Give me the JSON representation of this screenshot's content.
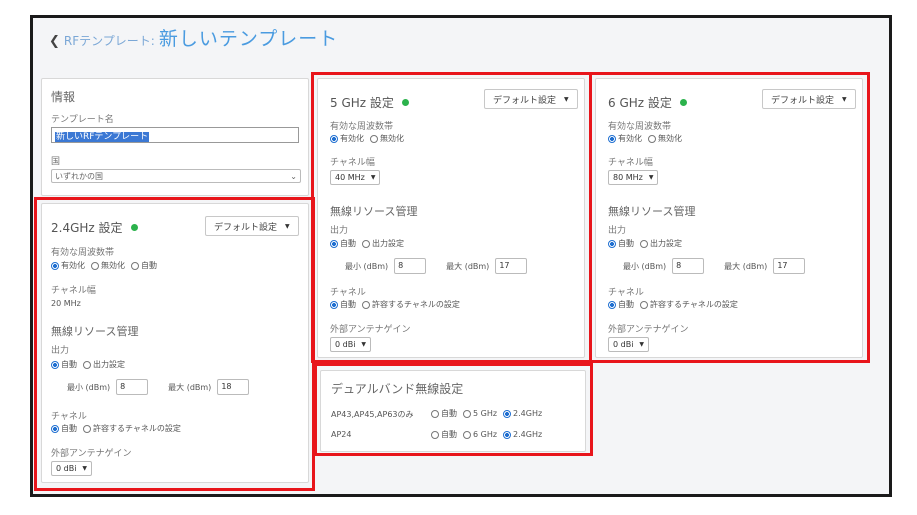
{
  "header": {
    "back_icon": "chevron-left-icon",
    "breadcrumb": "RFテンプレート:",
    "title": "新しいテンプレート"
  },
  "info": {
    "heading": "情報",
    "name_label": "テンプレート名",
    "name_value": "新しいRFテンプレート",
    "country_label": "国",
    "country_value": "いずれかの国"
  },
  "band24": {
    "title": "2.4GHz 設定",
    "status_color": "#2bb24c",
    "dropdown": "デフォルト設定",
    "freq_label": "有効な周波数帯",
    "freq_options": [
      "有効化",
      "無効化",
      "自動"
    ],
    "width_label": "チャネル幅",
    "width_value": "20 MHz",
    "rrm_label": "無線リソース管理",
    "power_label": "出力",
    "power_options": [
      "自動",
      "出力設定"
    ],
    "min_label": "最小 (dBm)",
    "min_value": "8",
    "max_label": "最大 (dBm)",
    "max_value": "18",
    "channel_label": "チャネル",
    "channel_options": [
      "自動",
      "許容するチャネルの設定"
    ],
    "ant_label": "外部アンテナゲイン",
    "ant_value": "0 dBi"
  },
  "band5": {
    "title": "5 GHz 設定",
    "dropdown": "デフォルト設定",
    "freq_label": "有効な周波数帯",
    "freq_options": [
      "有効化",
      "無効化"
    ],
    "width_label": "チャネル幅",
    "width_value": "40 MHz",
    "rrm_label": "無線リソース管理",
    "power_label": "出力",
    "power_options": [
      "自動",
      "出力設定"
    ],
    "min_label": "最小 (dBm)",
    "min_value": "8",
    "max_label": "最大 (dBm)",
    "max_value": "17",
    "channel_label": "チャネル",
    "channel_options": [
      "自動",
      "許容するチャネルの設定"
    ],
    "ant_label": "外部アンテナゲイン",
    "ant_value": "0 dBi"
  },
  "band6": {
    "title": "6 GHz 設定",
    "dropdown": "デフォルト設定",
    "freq_label": "有効な周波数帯",
    "freq_options": [
      "有効化",
      "無効化"
    ],
    "width_label": "チャネル幅",
    "width_value": "80 MHz",
    "rrm_label": "無線リソース管理",
    "power_label": "出力",
    "power_options": [
      "自動",
      "出力設定"
    ],
    "min_label": "最小 (dBm)",
    "min_value": "8",
    "max_label": "最大 (dBm)",
    "max_value": "17",
    "channel_label": "チャネル",
    "channel_options": [
      "自動",
      "許容するチャネルの設定"
    ],
    "ant_label": "外部アンテナゲイン",
    "ant_value": "0 dBi"
  },
  "dual": {
    "title": "デュアルバンド無線設定",
    "rows": [
      {
        "model": "AP43,AP45,AP63のみ",
        "options": [
          "自動",
          "5 GHz",
          "2.4GHz"
        ]
      },
      {
        "model": "AP24",
        "options": [
          "自動",
          "6 GHz",
          "2.4GHz"
        ]
      }
    ]
  },
  "highlight_color": "#e8151b"
}
